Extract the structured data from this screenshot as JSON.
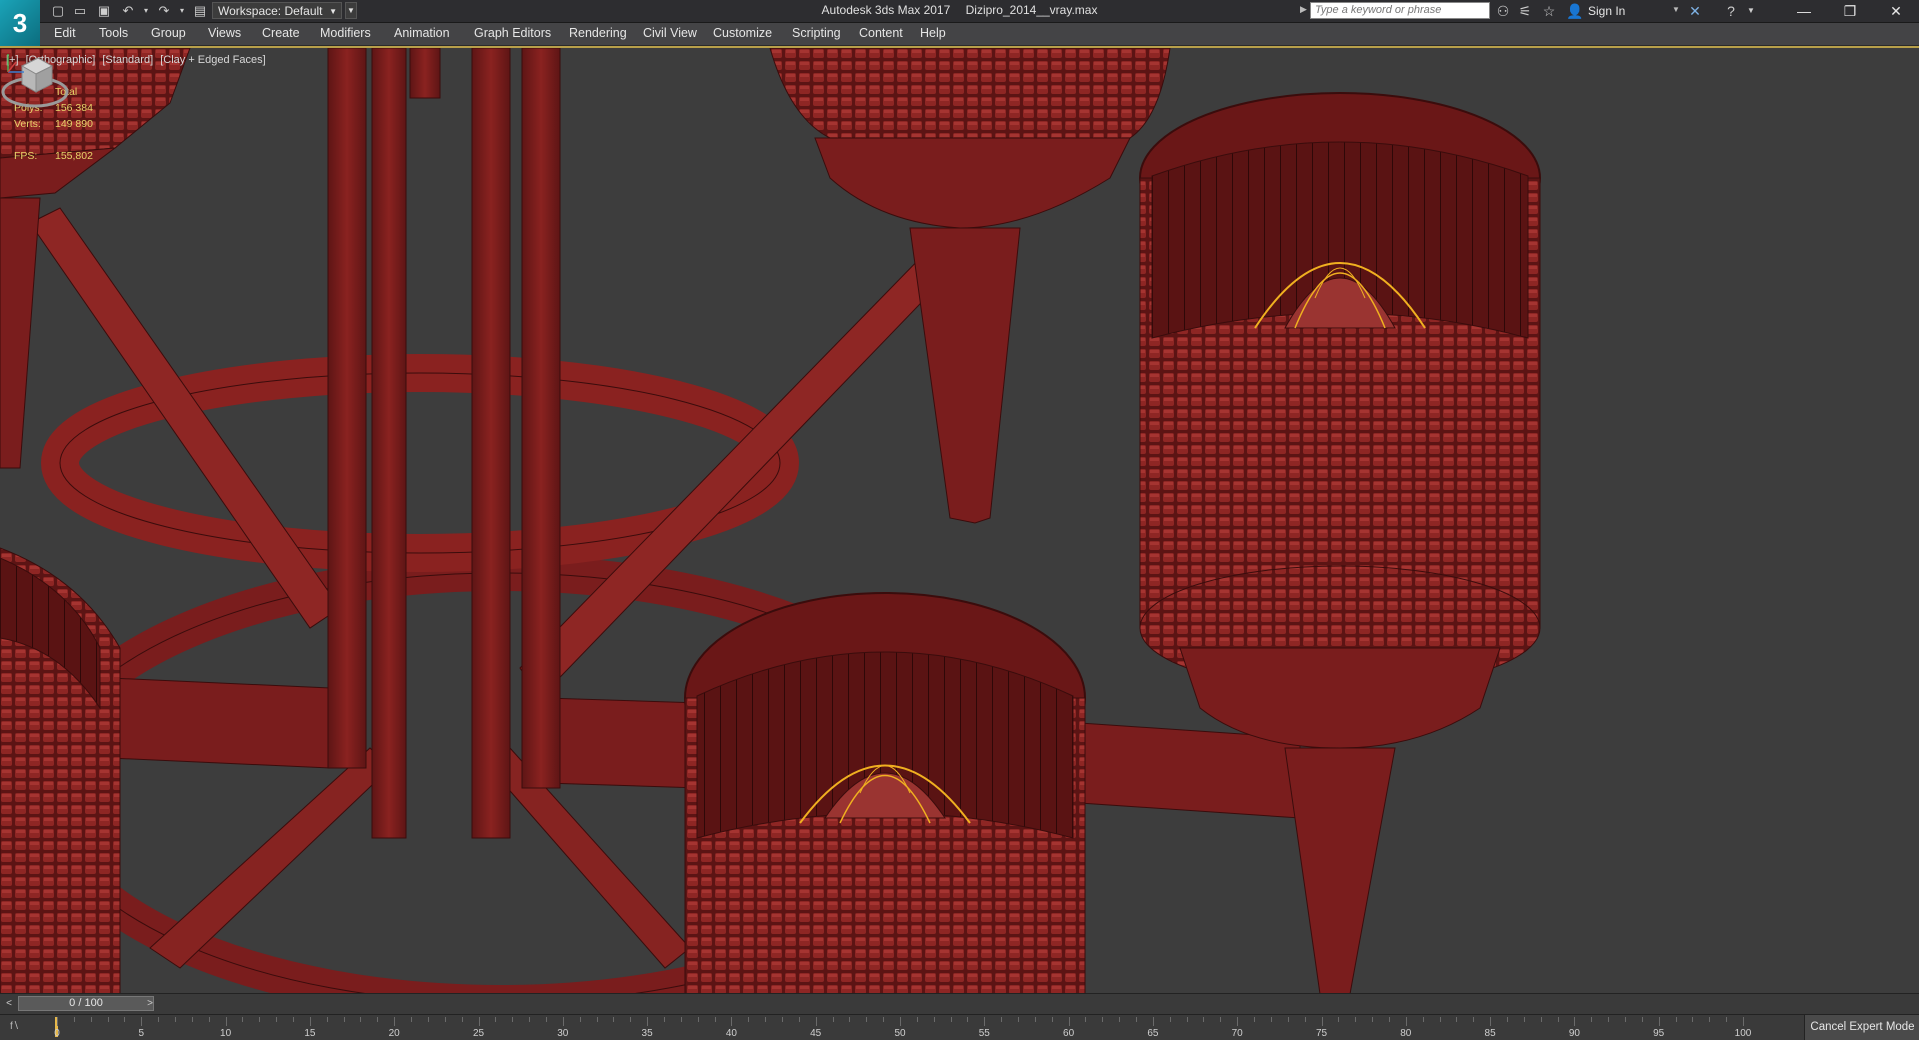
{
  "window": {
    "app_name": "Autodesk 3ds Max 2017",
    "file_name": "Dizipro_2014__vray.max",
    "logo_text": "3",
    "workspace": "Workspace: Default",
    "search_placeholder": "Type a keyword or phrase",
    "sign_in": "Sign In"
  },
  "menu": [
    "Edit",
    "Tools",
    "Group",
    "Views",
    "Create",
    "Modifiers",
    "Animation",
    "Graph Editors",
    "Rendering",
    "Civil View",
    "Customize",
    "Scripting",
    "Content",
    "Help"
  ],
  "viewport": {
    "label_parts": [
      "[+]",
      "[Orthographic]",
      "[Standard]",
      "[Clay + Edged Faces]"
    ],
    "stats_header": "Total",
    "polys_label": "Polys:",
    "polys_value": "156 384",
    "verts_label": "Verts:",
    "verts_value": "149 890",
    "fps_label": "FPS:",
    "fps_value": "155,802",
    "colors": {
      "background": "#3d3d3d",
      "model": "#7a1d1d",
      "model_light": "#962a28",
      "edge": "#3a0c0c",
      "selection": "#f0b020"
    }
  },
  "timeslider": {
    "position": "0 / 100",
    "prev": "<",
    "next": ">"
  },
  "trackbar": {
    "ticks": [
      "0",
      "5",
      "10",
      "15",
      "20",
      "25",
      "30",
      "35",
      "40",
      "45",
      "50",
      "55",
      "60",
      "65",
      "70",
      "75",
      "80",
      "85",
      "90",
      "95",
      "100"
    ],
    "expert_button": "Cancel Expert Mode"
  }
}
